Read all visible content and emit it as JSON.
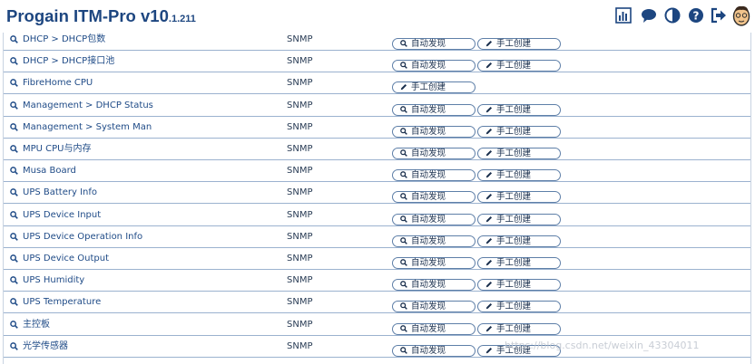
{
  "app": {
    "title": "Progain ITM-Pro",
    "version_major": "v10",
    "version_minor": ".1.211"
  },
  "toolbar": [
    {
      "icon": "bar-chart-icon"
    },
    {
      "icon": "chat-bubble-icon"
    },
    {
      "icon": "contrast-icon"
    },
    {
      "icon": "help-icon"
    },
    {
      "icon": "logout-icon"
    },
    {
      "icon": "avatar"
    }
  ],
  "buttons": {
    "auto_label": "自动发现",
    "manual_label": "手工创建"
  },
  "rows": [
    {
      "name": "DHCP > DHCP包数",
      "protocol": "SNMP",
      "auto": true
    },
    {
      "name": "DHCP > DHCP接口池",
      "protocol": "SNMP",
      "auto": true
    },
    {
      "name": "FibreHome CPU",
      "protocol": "SNMP",
      "auto": false
    },
    {
      "name": "Management > DHCP Status",
      "protocol": "SNMP",
      "auto": true
    },
    {
      "name": "Management > System Man",
      "protocol": "SNMP",
      "auto": true
    },
    {
      "name": "MPU CPU与内存",
      "protocol": "SNMP",
      "auto": true
    },
    {
      "name": "Musa Board",
      "protocol": "SNMP",
      "auto": true
    },
    {
      "name": "UPS Battery Info",
      "protocol": "SNMP",
      "auto": true
    },
    {
      "name": "UPS Device Input",
      "protocol": "SNMP",
      "auto": true
    },
    {
      "name": "UPS Device Operation Info",
      "protocol": "SNMP",
      "auto": true
    },
    {
      "name": "UPS Device Output",
      "protocol": "SNMP",
      "auto": true
    },
    {
      "name": "UPS Humidity",
      "protocol": "SNMP",
      "auto": true
    },
    {
      "name": "UPS Temperature",
      "protocol": "SNMP",
      "auto": true
    },
    {
      "name": "主控板",
      "protocol": "SNMP",
      "auto": true
    },
    {
      "name": "光学传感器",
      "protocol": "SNMP",
      "auto": true
    }
  ],
  "watermark": "https://blog.csdn.net/weixin_43304011"
}
